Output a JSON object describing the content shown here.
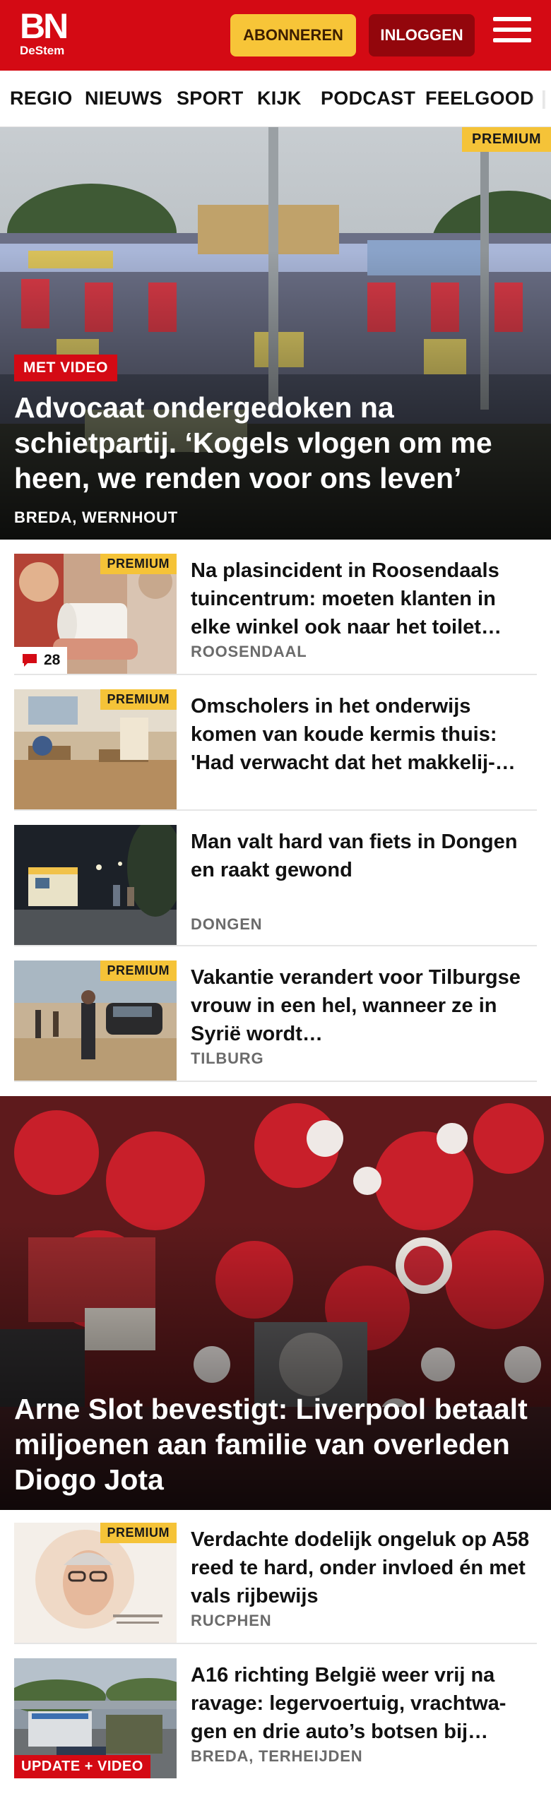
{
  "header": {
    "logo_main": "BN",
    "logo_sub": "DeStem",
    "subscribe_label": "ABONNEREN",
    "login_label": "INLOGGEN",
    "menu_icon": "hamburger-menu-icon",
    "brand_color": "#d40a14",
    "accent_color": "#f7c538"
  },
  "nav": {
    "items": [
      "REGIO",
      "NIEUWS",
      "SPORT",
      "KIJK",
      "PODCAST",
      "FEELGOOD"
    ]
  },
  "hero1": {
    "premium_label": "PREMIUM",
    "tag": "MET VIDEO",
    "title": "Advocaat ondergedoken na schietpar­tij. ‘Kogels vlogen om me heen, we renden voor ons leven’",
    "location": "BREDA, WERNHOUT"
  },
  "articles": [
    {
      "premium_label": "PREMIUM",
      "title": "Na plasincident in Roosendaals tuincentrum: moeten klanten in elke winkel ook naar het toilet…",
      "location": "ROOSENDAAL",
      "comments": "28"
    },
    {
      "premium_label": "PREMIUM",
      "title": "Omscholers in het onderwijs komen van koude kermis thuis: 'Had verwacht dat het makkelij-…",
      "location": ""
    },
    {
      "title": "Man valt hard van fiets in Dongen en raakt gewond",
      "location": "DONGEN"
    },
    {
      "premium_label": "PREMIUM",
      "title": "Vakantie verandert voor Tilburgse vrouw in een hel, wanneer ze in Syrië wordt…",
      "location": "TILBURG"
    }
  ],
  "hero2": {
    "title": "Arne Slot bevestigt: Liverpool betaalt miljoenen aan familie van overleden Diogo Jota"
  },
  "articles2": [
    {
      "premium_label": "PREMIUM",
      "title": "Verdachte dodelijk ongeluk op A58 reed te hard, onder invloed én met vals rijbewijs",
      "location": "RUCPHEN"
    },
    {
      "tag": "UPDATE + VIDEO",
      "title": "A16 richting België weer vrij na ravage: legervoertuig, vrachtwa­gen en drie auto’s botsen bij…",
      "location": "BREDA, TERHEIJDEN"
    }
  ]
}
